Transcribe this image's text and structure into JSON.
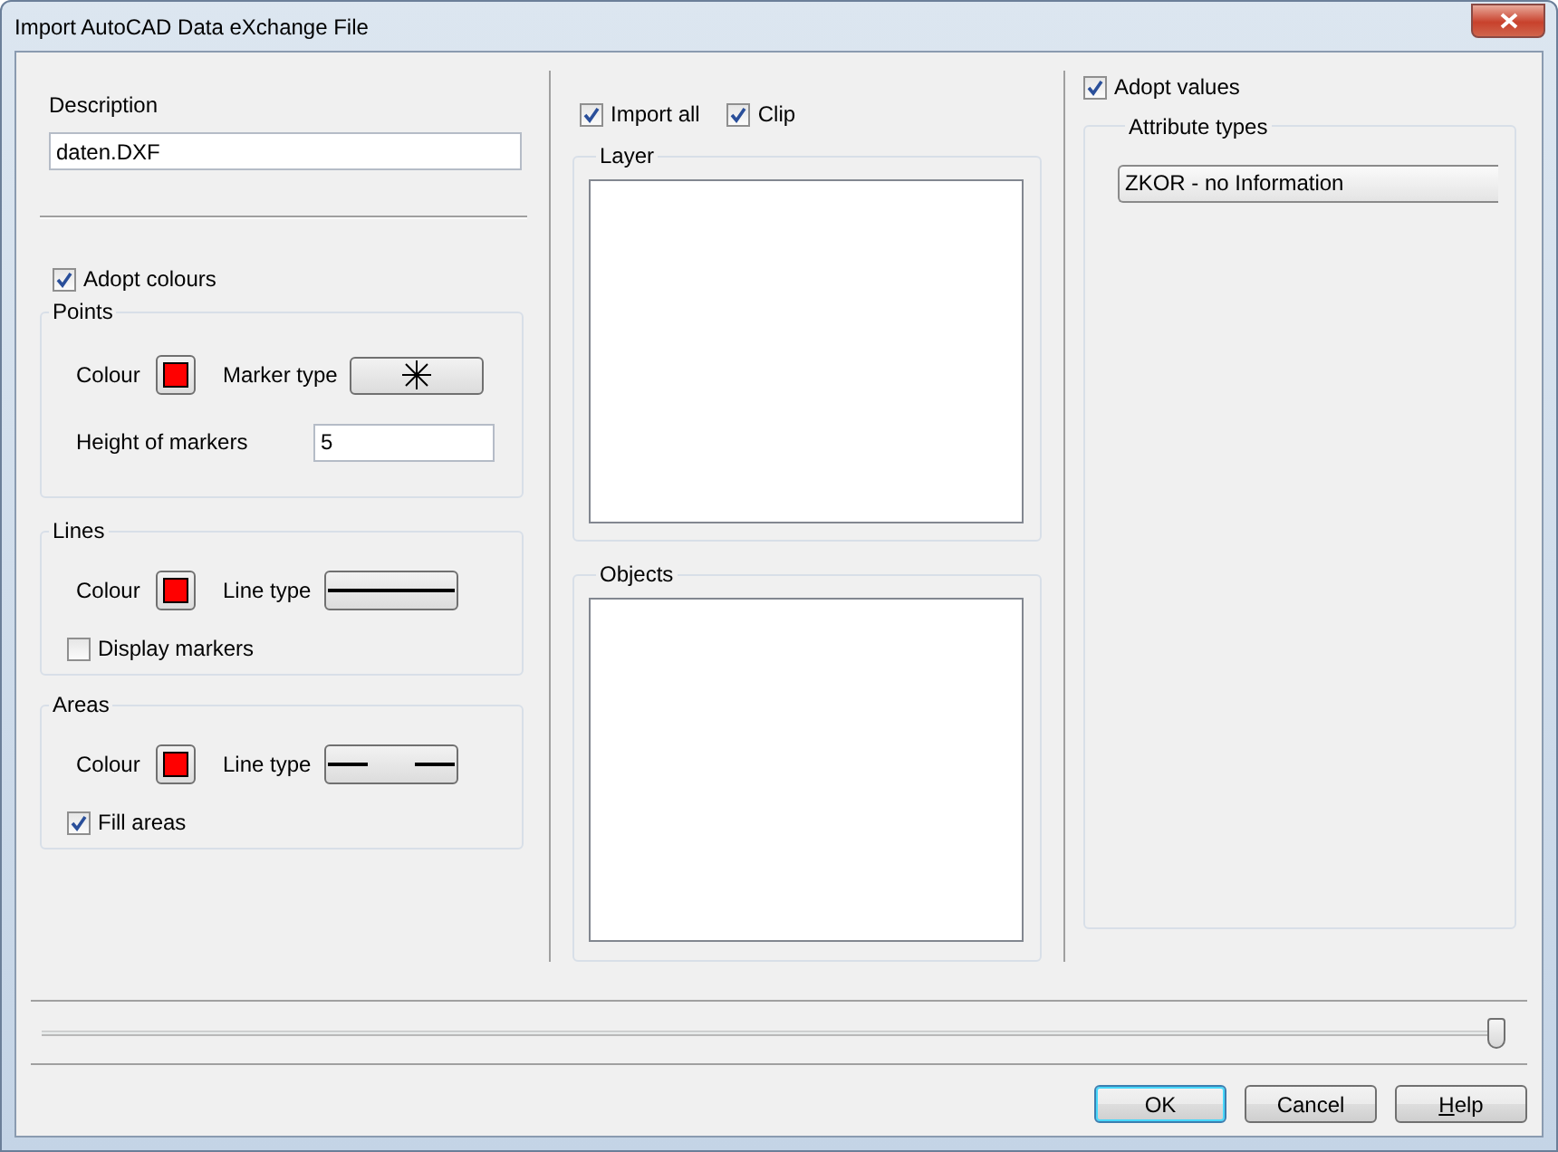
{
  "window": {
    "title": "Import AutoCAD Data eXchange File"
  },
  "description": {
    "label": "Description",
    "value": "daten.DXF"
  },
  "adopt_colours": {
    "label": "Adopt colours",
    "checked": true
  },
  "groups": [
    {
      "title": "Points",
      "colour_label": "Colour",
      "color": "#ff0000",
      "type_label": "Marker type",
      "kind": "star",
      "height_label": "Height of markers",
      "height_value": "5"
    },
    {
      "title": "Lines",
      "colour_label": "Colour",
      "color": "#ff0000",
      "type_label": "Line type",
      "kind": "solid",
      "option": {
        "label": "Display markers",
        "checked": false
      }
    },
    {
      "title": "Areas",
      "colour_label": "Colour",
      "color": "#ff0000",
      "type_label": "Line type",
      "kind": "dashed",
      "option": {
        "label": "Fill areas",
        "checked": true
      }
    }
  ],
  "import_options": [
    {
      "label": "Import all",
      "checked": true
    },
    {
      "label": "Clip",
      "checked": true
    }
  ],
  "lists": [
    {
      "title": "Layer"
    },
    {
      "title": "Objects"
    }
  ],
  "adopt_values": {
    "label": "Adopt values",
    "checked": true
  },
  "attribute_types": {
    "title": "Attribute types",
    "items": [
      {
        "label": "ZKOR - no Information"
      }
    ]
  },
  "slider": {
    "level": 1
  },
  "buttons": [
    {
      "label": "OK",
      "default": true,
      "underline_first": false
    },
    {
      "label": "Cancel",
      "default": false,
      "underline_first": false
    },
    {
      "label": "Help",
      "default": false,
      "underline_first": true
    }
  ]
}
